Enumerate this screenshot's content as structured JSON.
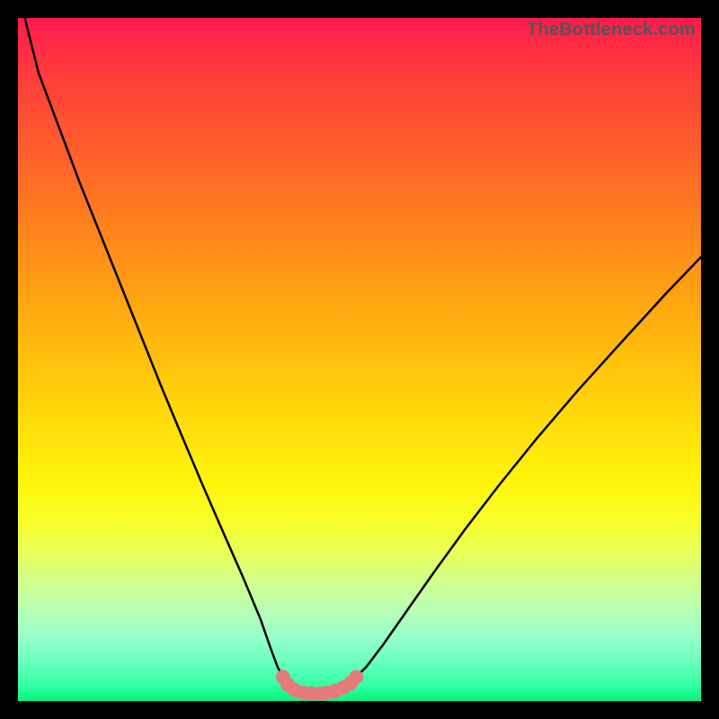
{
  "attribution": "TheBottleneck.com",
  "colors": {
    "page_bg": "#000000",
    "curve_stroke": "#000000",
    "marker_stroke": "#e77a7a",
    "marker_fill": "#e77a7a",
    "gradient_stops": [
      "#ff1a4d",
      "#ff3b3b",
      "#ff5a2e",
      "#ff7a1f",
      "#ff9a14",
      "#ffba0d",
      "#ffd90a",
      "#fff50a",
      "#f7ff2a",
      "#e8ff55",
      "#d4ff85",
      "#bdffb0",
      "#9dffc9",
      "#6effc0",
      "#2dff9f",
      "#05f57a"
    ]
  },
  "chart_data": {
    "type": "line",
    "title": "",
    "xlabel": "",
    "ylabel": "",
    "xlim": [
      0,
      100
    ],
    "ylim": [
      0,
      100
    ],
    "grid": false,
    "series": [
      {
        "name": "left-curve",
        "x": [
          1,
          3,
          6,
          9,
          12,
          15,
          18,
          21,
          24,
          27,
          30,
          33,
          35.5,
          37,
          38,
          38.8
        ],
        "y": [
          100,
          92,
          84,
          76,
          68.5,
          61,
          53.5,
          46,
          38.8,
          31.7,
          24.8,
          18,
          12,
          7.7,
          5,
          3.5
        ]
      },
      {
        "name": "right-curve",
        "x": [
          49.5,
          51,
          53.5,
          57,
          61,
          65.5,
          70.5,
          76,
          82,
          88.5,
          95,
          100
        ],
        "y": [
          3.5,
          5,
          8.3,
          13.3,
          19,
          25.2,
          31.7,
          38.5,
          45.5,
          52.7,
          59.8,
          65
        ]
      },
      {
        "name": "optimal-zone",
        "x": [
          38.8,
          39.5,
          40.5,
          41.8,
          43,
          44.2,
          45.3,
          46.5,
          47.7,
          48.7,
          49.5
        ],
        "y": [
          3.5,
          2.4,
          1.6,
          1.2,
          1.1,
          1.1,
          1.2,
          1.5,
          2.0,
          2.6,
          3.5
        ]
      }
    ],
    "annotations": []
  }
}
